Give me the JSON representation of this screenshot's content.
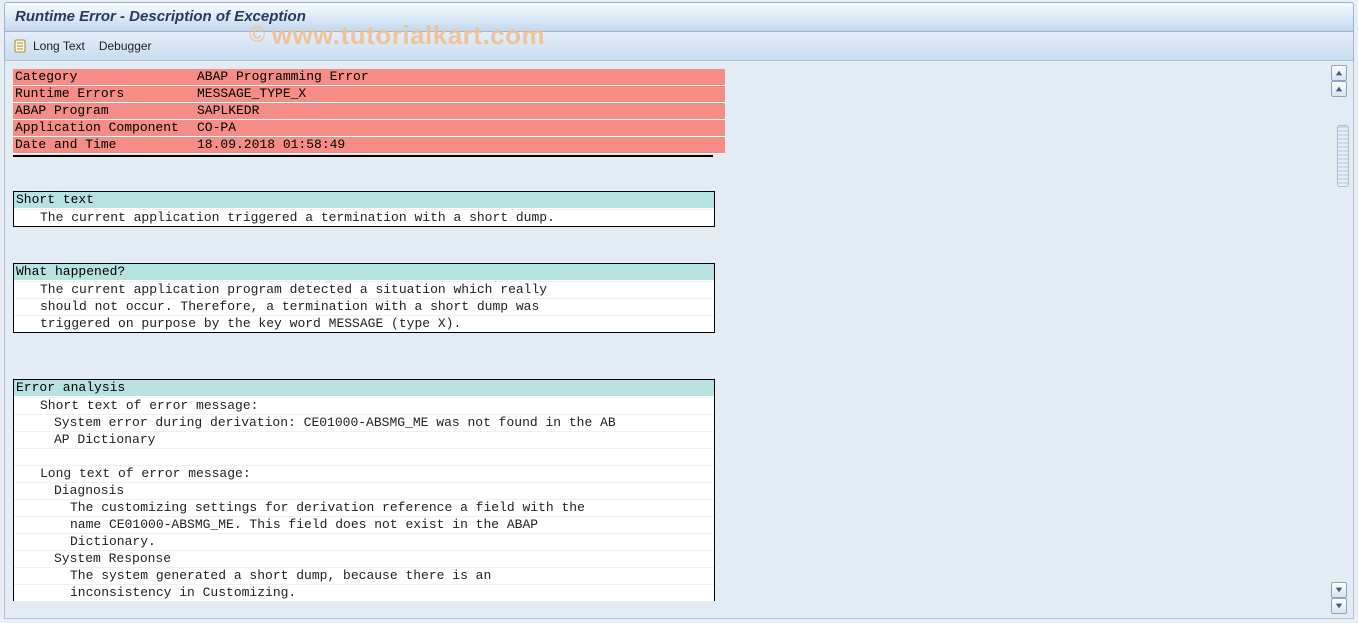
{
  "title": "Runtime Error - Description of Exception",
  "toolbar": {
    "long_text": "Long Text",
    "debugger": "Debugger"
  },
  "watermark": "www.tutorialkart.com",
  "header": {
    "rows": [
      {
        "label": "Category",
        "value": "ABAP Programming Error"
      },
      {
        "label": "Runtime Errors",
        "value": "MESSAGE_TYPE_X"
      },
      {
        "label": "ABAP Program",
        "value": "SAPLKEDR"
      },
      {
        "label": "Application Component",
        "value": "CO-PA"
      },
      {
        "label": "Date and Time",
        "value": "18.09.2018 01:58:49"
      }
    ]
  },
  "sections": {
    "short_text": {
      "title": "Short text",
      "lines": [
        "The current application triggered a termination with a short dump."
      ]
    },
    "what_happened": {
      "title": "What happened?",
      "lines": [
        "The current application program detected a situation which really",
        "should not occur. Therefore, a termination with a short dump was",
        "triggered on purpose by the key word MESSAGE (type X)."
      ]
    },
    "error_analysis": {
      "title": "Error analysis",
      "short_text_label": "Short text of error message:",
      "short_text_lines": [
        "System error during derivation: CE01000-ABSMG_ME was not found in the AB",
        "AP Dictionary"
      ],
      "long_text_label": "Long text of error message:",
      "diag_label": "Diagnosis",
      "diag_lines": [
        "The customizing settings for derivation reference a field with the",
        "name CE01000-ABSMG_ME. This field does not exist in the ABAP",
        "Dictionary."
      ],
      "sysresp_label": "System Response",
      "sysresp_lines": [
        "The system generated a short dump, because there is an",
        "inconsistency in Customizing."
      ]
    }
  }
}
